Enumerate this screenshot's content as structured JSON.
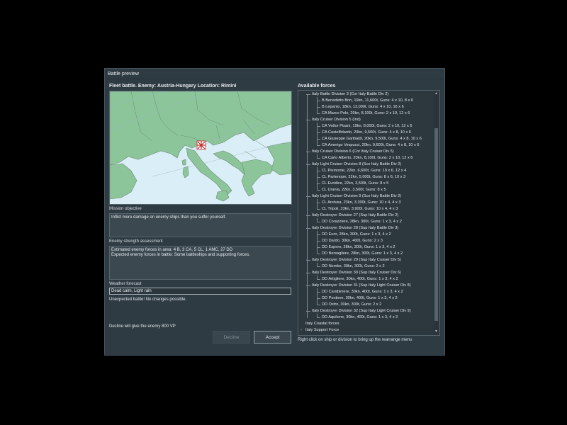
{
  "dialog": {
    "title": "Battle preview"
  },
  "battle": {
    "header": "Fleet battle. Enemy: Austria-Hungary Location: Rimini"
  },
  "mission": {
    "label": "Mission objective",
    "text": "Inflict more damage on enemy ships than you suffer yourself."
  },
  "enemy": {
    "label": "Enemy strength assessment",
    "line1": "Estimated enemy forces in area:  4 B,  3 CA,  5 CL,  1 AMC,  27 DD",
    "line2": "Expected enemy forces in battle: Some battleships and supporting forces."
  },
  "weather": {
    "label": "Weather forecast",
    "value": "Dead calm, Light rain"
  },
  "notes": {
    "unexpected": "Unexpected battle! No changes possible.",
    "decline_info": "Decline will give the enemy 800 VP"
  },
  "buttons": {
    "decline": "Decline",
    "accept": "Accept"
  },
  "forces": {
    "title": "Available forces",
    "hint": "Right click on ship or division to bring up the rearrange menu",
    "rows": [
      {
        "text": "Italy Battle Division 3 (Cor Italy Battle Div 2)",
        "level": 1,
        "arrow": "down"
      },
      {
        "text": "B Benedetto Brin, 19kn, 11,600t, Guns: 4 x 10, 8 x 6",
        "level": 2
      },
      {
        "text": "B Lepanto, 18kn, 13,000t, Guns: 4 x 10, 16 x 6",
        "level": 2
      },
      {
        "text": "CA Marco Polo, 20kn, 8,100t, Guns: 2 x 10, 12 x 6",
        "level": 2
      },
      {
        "text": "Italy Cruiser Division 5 (Ind)",
        "level": 1,
        "arrow": "down"
      },
      {
        "text": "CA Vettor Pisani, 19kn, 8,000t, Guns: 2 x 10, 12 x 6",
        "level": 2
      },
      {
        "text": "CA Castelfidardo, 20kn, 9,500t, Guns: 4 x 8, 10 x 6",
        "level": 2
      },
      {
        "text": "CA Giuseppe Garibaldi, 20kn, 9,500t, Guns: 4 x 8, 10 x 6",
        "level": 2
      },
      {
        "text": "CA Amerigo Vespucci, 20kn, 9,600t, Guns: 4 x 8, 10 x 6",
        "level": 2
      },
      {
        "text": "Italy Cruiser Division 6 (Cor Italy Cruiser Div 5)",
        "level": 1,
        "arrow": "down"
      },
      {
        "text": "CA Carlo Alberto, 20kn, 8,100t, Guns: 2 x 10, 12 x 6",
        "level": 2
      },
      {
        "text": "Italy Light Cruiser Division 8 (Sco Italy Battle Div 2)",
        "level": 1,
        "arrow": "down"
      },
      {
        "text": "CL Piemonte, 22kn, 6,600t, Guns: 10 x 6, 12 x 4",
        "level": 2
      },
      {
        "text": "CL Partenope, 22kn, 5,000t, Guns: 8 x 6, 10 x 3",
        "level": 2
      },
      {
        "text": "CL Euridice, 22kn, 3,500t, Guns: 8 x 5",
        "level": 2
      },
      {
        "text": "CL Urania, 22kn, 3,500t, Guns: 8 x 5",
        "level": 2
      },
      {
        "text": "Italy Light Cruiser Division 9 (Sco Italy Battle Div 2)",
        "level": 1,
        "arrow": "down"
      },
      {
        "text": "CL Aretusa, 23kn, 3,300t, Guns: 10 x 4, 4 x 3",
        "level": 2
      },
      {
        "text": "CL Tripoli, 23kn, 3,900t, Guns: 10 x 4, 4 x 3",
        "level": 2
      },
      {
        "text": "Italy Destroyer Division 27 (Sup Italy Battle Div 2)",
        "level": 1,
        "arrow": "down"
      },
      {
        "text": "DD Corazziere, 28kn, 300t, Guns: 1 x 3, 4 x 2",
        "level": 2
      },
      {
        "text": "Italy Destroyer Division 28 (Sup Italy Battle Div 3)",
        "level": 1,
        "arrow": "down"
      },
      {
        "text": "DD Euro, 28kn, 300t, Guns: 1 x 3, 4 x 2",
        "level": 2
      },
      {
        "text": "DD Dardo, 30kn, 400t, Guns: 2 x 3",
        "level": 2
      },
      {
        "text": "DD Espero, 28kn, 300t, Guns: 1 x 3, 4 x 2",
        "level": 2
      },
      {
        "text": "DD Bersagliere, 28kn, 300t, Guns: 1 x 3, 4 x 2",
        "level": 2
      },
      {
        "text": "Italy Destroyer Division 29 (Sup Italy Cruiser Div 5)",
        "level": 1,
        "arrow": "down"
      },
      {
        "text": "DD Nembo, 30kn, 300t, Guns: 2 x 2",
        "level": 2
      },
      {
        "text": "Italy Destroyer Division 30 (Sup Italy Cruiser Div 6)",
        "level": 1,
        "arrow": "down"
      },
      {
        "text": "DD Artigliere, 30kn, 400t, Guns: 1 x 3, 4 x 2",
        "level": 2
      },
      {
        "text": "Italy Destroyer Division 31 (Sup Italy Light Cruiser Div 8)",
        "level": 1,
        "arrow": "down"
      },
      {
        "text": "DD Carabiniere, 30kn, 400t, Guns: 1 x 3, 4 x 2",
        "level": 2
      },
      {
        "text": "DD Pontiere, 30kn, 400t, Guns: 1 x 3, 4 x 2",
        "level": 2
      },
      {
        "text": "DD Ostro, 30kn, 300t, Guns: 2 x 2",
        "level": 2
      },
      {
        "text": "Italy Destroyer Division 32 (Sup Italy Light Cruiser Div 9)",
        "level": 1,
        "arrow": "down"
      },
      {
        "text": "DD Aquilone, 30kn, 400t, Guns: 1 x 3, 4 x 2",
        "level": 2
      },
      {
        "text": "Italy Coastal forces",
        "level": 0
      },
      {
        "text": "Italy Support Force",
        "level": 0,
        "arrow": "right"
      }
    ]
  },
  "colors": {
    "dialog_bg": "#2f3b43",
    "sea": "#d9eef6",
    "land": "#8cc59a",
    "border": "#6f8a78"
  },
  "map": {
    "marker_icon": "battle-cross-icon"
  }
}
